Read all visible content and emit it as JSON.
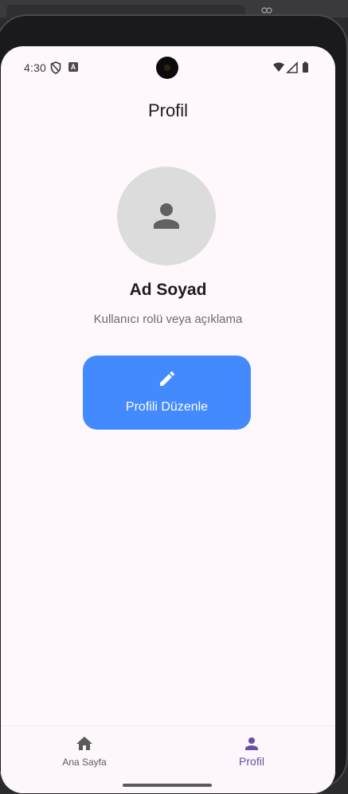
{
  "status_bar": {
    "time": "4:30",
    "a_badge": "A"
  },
  "page": {
    "title": "Profil"
  },
  "profile": {
    "name": "Ad Soyad",
    "description": "Kullanıcı rolü veya açıklama"
  },
  "edit_button": {
    "label": "Profili Düzenle"
  },
  "bottom_nav": {
    "items": [
      {
        "label": "Ana Sayfa",
        "icon": "home-icon",
        "active": false
      },
      {
        "label": "Profil",
        "icon": "person-icon",
        "active": true
      }
    ]
  },
  "colors": {
    "background": "#fef7fc",
    "accent": "#448aff",
    "nav_active": "#6750a4",
    "avatar_bg": "#dcdcdc"
  }
}
